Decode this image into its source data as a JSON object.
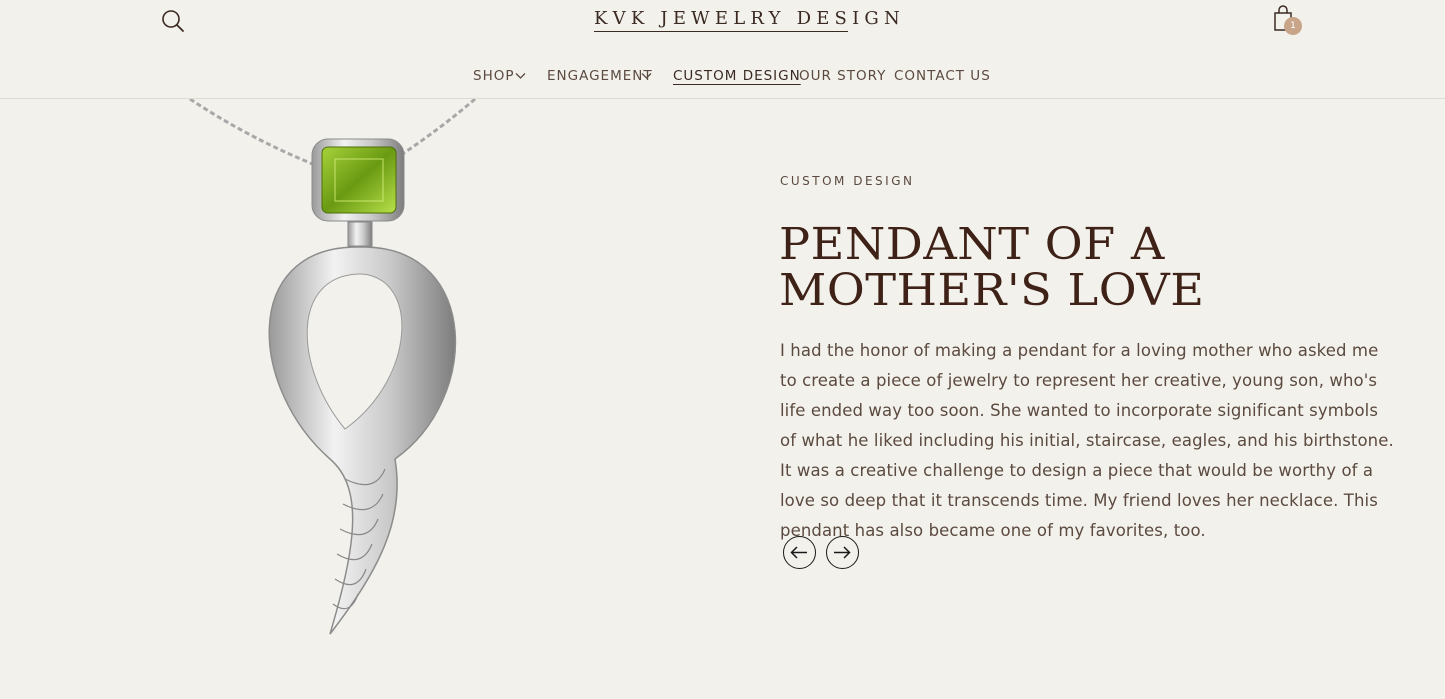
{
  "header": {
    "logo": "KVK JEWELRY DESIGN",
    "cart_count": "1",
    "icons": {
      "search": "search-icon",
      "cart": "shopping-bag-icon"
    }
  },
  "nav": {
    "items": [
      {
        "label": "SHOP",
        "has_dropdown": true
      },
      {
        "label": "ENGAGEMENT",
        "has_dropdown": true
      },
      {
        "label": "CUSTOM DESIGN",
        "active": true
      },
      {
        "label": "OUR STORY"
      },
      {
        "label": "CONTACT US"
      }
    ]
  },
  "main": {
    "image_alt": "pendant-image",
    "eyebrow": "CUSTOM DESIGN",
    "title": "PENDANT OF A MOTHER'S LOVE",
    "body": "I had the honor of making a pendant for a loving mother who asked me to create a piece of jewelry to represent her creative, young son, who's life ended way too soon.  She wanted to incorporate significant symbols of what he liked including his initial, staircase, eagles, and his birthstone. It was a creative challenge to design a piece that would be worthy of a love so deep that it transcends time.  My friend loves her necklace.  This pendant has also became one of my favorites, too.",
    "controls": {
      "prev": "arrow-left-icon",
      "next": "arrow-right-icon"
    }
  },
  "colors": {
    "background": "#f3f1ec",
    "title": "#3f2217",
    "text": "#5b4a3f",
    "badge": "#c8a589",
    "gem": "#8cbf2a",
    "metal": "#d8d8d8"
  }
}
